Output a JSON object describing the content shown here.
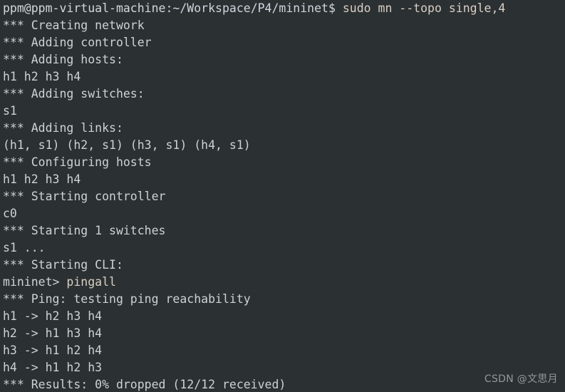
{
  "terminal": {
    "background_color": "#2b3033",
    "output_color": "#ccd2d6",
    "command_color": "#d9cfc4",
    "watermark_color": "#b9bfc4",
    "prompt": {
      "user_host": "ppm@ppm-virtual-machine",
      "separator": ":",
      "path": "~/Workspace/P4/mininet",
      "sigil": "$",
      "command": " sudo mn --topo single,4"
    },
    "mininet_prompt": {
      "label": "mininet>",
      "command": " pingall"
    },
    "lines": [
      {
        "id": "line-1",
        "kind": "prompt",
        "text": "ppm@ppm-virtual-machine:~/Workspace/P4/mininet$ sudo mn --topo single,4"
      },
      {
        "id": "line-2",
        "kind": "output",
        "text": "*** Creating network"
      },
      {
        "id": "line-3",
        "kind": "output",
        "text": "*** Adding controller"
      },
      {
        "id": "line-4",
        "kind": "output",
        "text": "*** Adding hosts:"
      },
      {
        "id": "line-5",
        "kind": "output",
        "text": "h1 h2 h3 h4"
      },
      {
        "id": "line-6",
        "kind": "output",
        "text": "*** Adding switches:"
      },
      {
        "id": "line-7",
        "kind": "output",
        "text": "s1"
      },
      {
        "id": "line-8",
        "kind": "output",
        "text": "*** Adding links:"
      },
      {
        "id": "line-9",
        "kind": "output",
        "text": "(h1, s1) (h2, s1) (h3, s1) (h4, s1)"
      },
      {
        "id": "line-10",
        "kind": "output",
        "text": "*** Configuring hosts"
      },
      {
        "id": "line-11",
        "kind": "output",
        "text": "h1 h2 h3 h4"
      },
      {
        "id": "line-12",
        "kind": "output",
        "text": "*** Starting controller"
      },
      {
        "id": "line-13",
        "kind": "output",
        "text": "c0"
      },
      {
        "id": "line-14",
        "kind": "output",
        "text": "*** Starting 1 switches"
      },
      {
        "id": "line-15",
        "kind": "output",
        "text": "s1 ..."
      },
      {
        "id": "line-16",
        "kind": "output",
        "text": "*** Starting CLI:"
      },
      {
        "id": "line-17",
        "kind": "mininet-prompt",
        "text": "mininet> pingall"
      },
      {
        "id": "line-18",
        "kind": "output",
        "text": "*** Ping: testing ping reachability"
      },
      {
        "id": "line-19",
        "kind": "output",
        "text": "h1 -> h2 h3 h4"
      },
      {
        "id": "line-20",
        "kind": "output",
        "text": "h2 -> h1 h3 h4"
      },
      {
        "id": "line-21",
        "kind": "output",
        "text": "h3 -> h1 h2 h4"
      },
      {
        "id": "line-22",
        "kind": "output",
        "text": "h4 -> h1 h2 h3"
      },
      {
        "id": "line-23",
        "kind": "output",
        "text": "*** Results: 0% dropped (12/12 received)"
      }
    ]
  },
  "watermark": {
    "text": "CSDN @文思月"
  }
}
